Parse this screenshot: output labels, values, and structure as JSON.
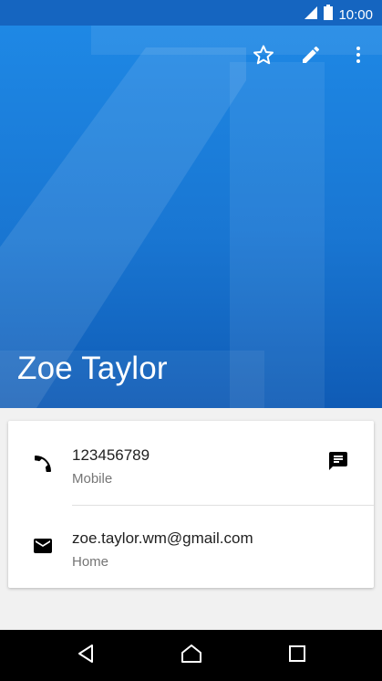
{
  "status_bar": {
    "time": "10:00"
  },
  "header": {
    "contact_name": "Zoe Taylor",
    "actions": [
      "star-icon",
      "edit-icon",
      "more-options-icon"
    ],
    "colors": {
      "background": "#1976d2",
      "status_bar": "#1565c0"
    }
  },
  "contact_details": {
    "phone": {
      "number": "123456789",
      "type": "Mobile",
      "icon": "phone-icon",
      "action_icon": "message-icon"
    },
    "email": {
      "address": "zoe.taylor.wm@gmail.com",
      "type": "Home",
      "icon": "email-icon"
    }
  },
  "nav_bar": {
    "buttons": [
      "back-icon",
      "home-icon",
      "recents-icon"
    ]
  }
}
